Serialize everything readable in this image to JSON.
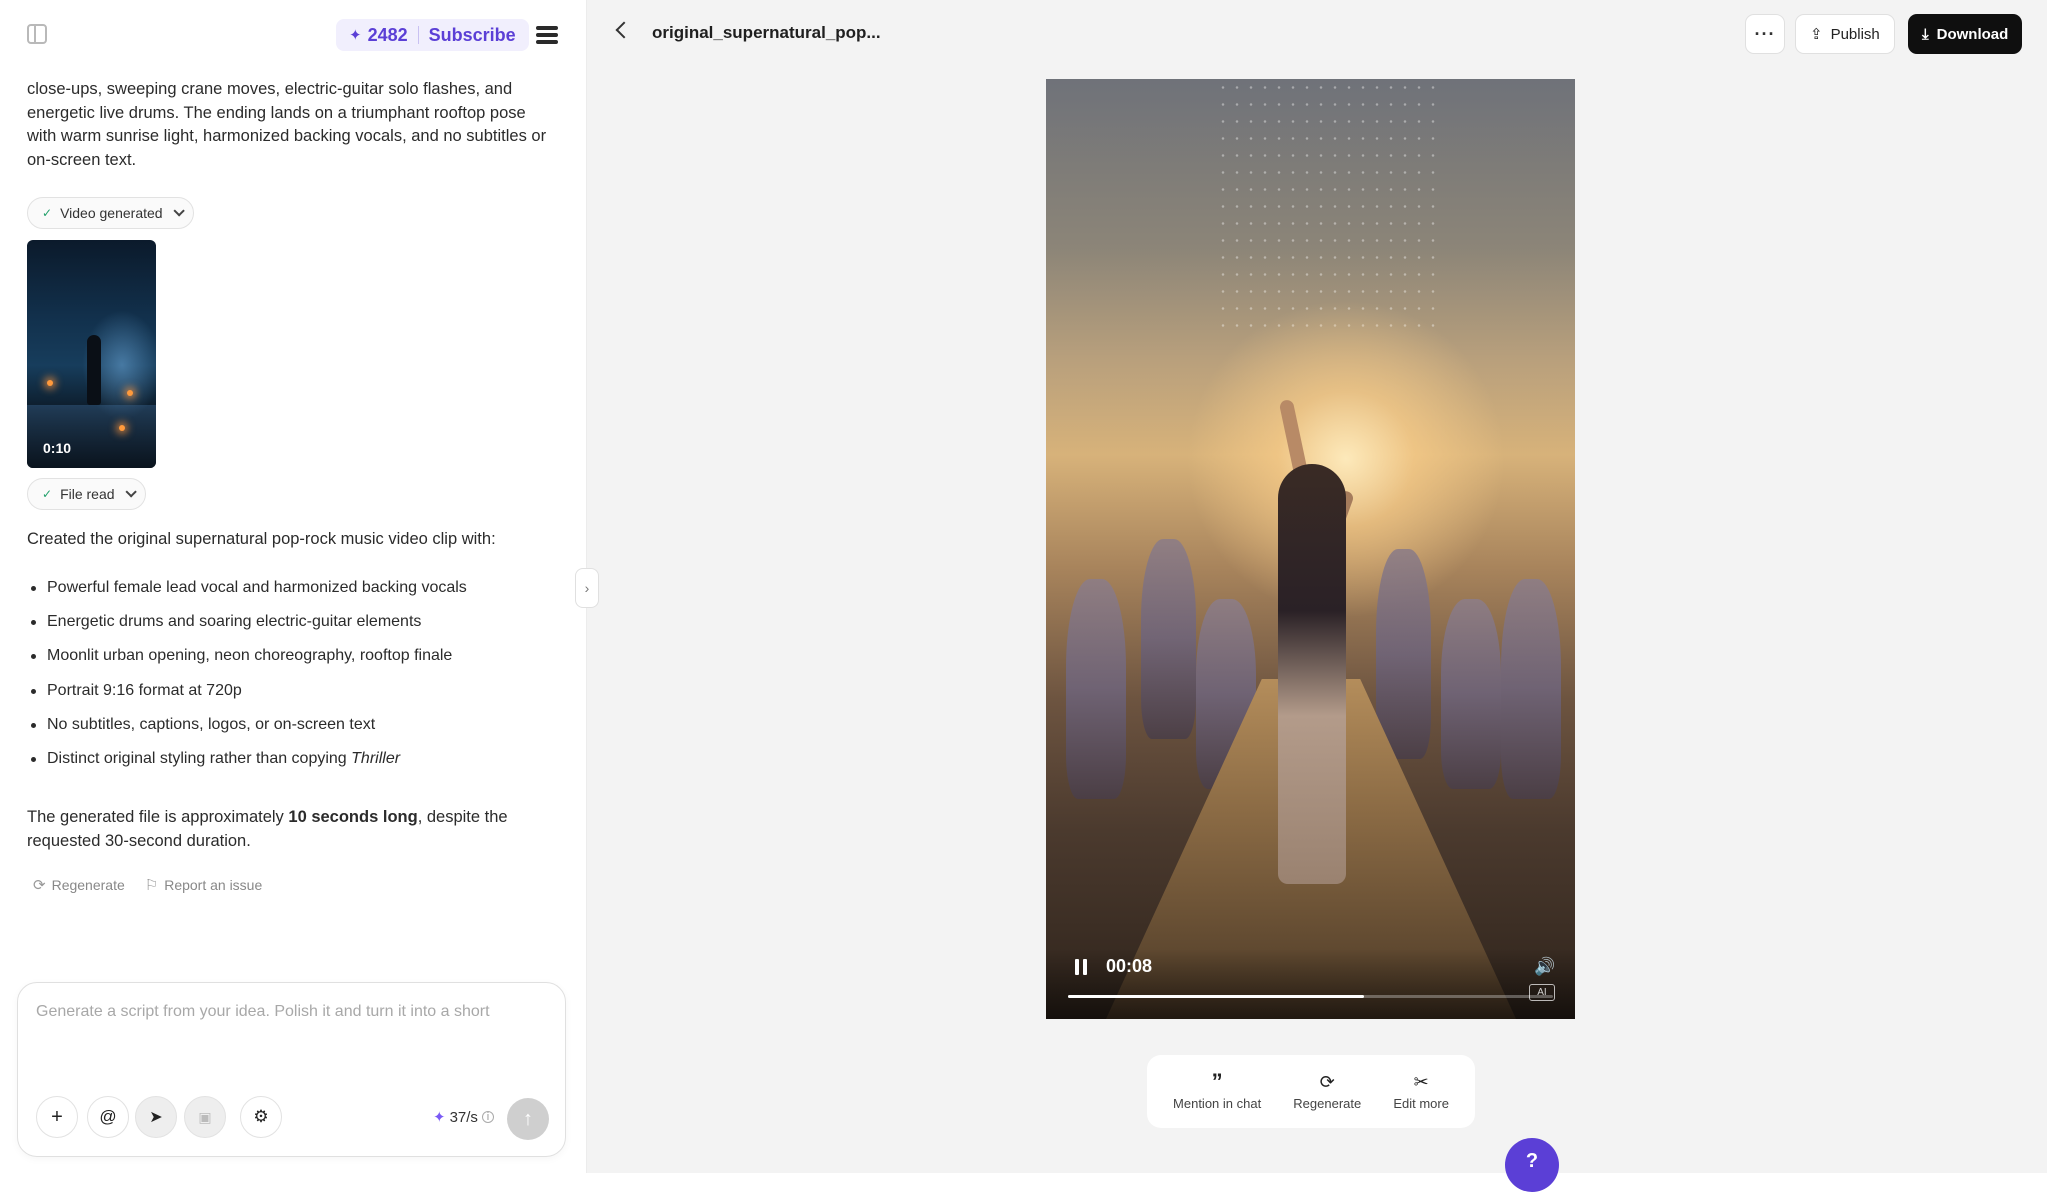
{
  "header": {
    "credits": "2482",
    "subscribe_label": "Subscribe",
    "credit_icon": "sparkle-icon"
  },
  "chat": {
    "message_text": "close-ups, sweeping crane moves, electric-guitar solo flashes, and energetic live drums. The ending lands on a triumphant rooftop pose with warm sunrise light, harmonized backing vocals, and no subtitles or on-screen text.",
    "video_status_label": "Video generated",
    "thumbnail_duration": "0:10",
    "file_status_label": "File read",
    "created_line": "Created the original supernatural pop-rock music video clip with:",
    "bullets": [
      "Powerful female lead vocal and harmonized backing vocals",
      "Energetic drums and soaring electric-guitar elements",
      "Moonlit urban opening, neon choreography, rooftop finale",
      "Portrait 9:16 format at 720p",
      "No subtitles, captions, logos, or on-screen text"
    ],
    "last_bullet_prefix": "Distinct original styling rather than copying ",
    "last_bullet_title": "Thriller",
    "summary_prefix": "The generated file is approximately ",
    "summary_bold": "10 seconds long",
    "summary_suffix": ", despite the requested 30-second duration.",
    "regenerate_label": "Regenerate",
    "report_label": "Report an issue"
  },
  "composer": {
    "placeholder": "Generate a script from your idea. Polish it and turn it into a short",
    "rate": "37/s",
    "tools": [
      "plus-icon",
      "mention-icon",
      "cursor-icon",
      "media-icon",
      "settings-sliders-icon"
    ]
  },
  "preview": {
    "file_title": "original_supernatural_pop...",
    "more_label": "···",
    "publish_label": "Publish",
    "download_label": "Download",
    "current_time": "00:08",
    "progress": 0.61,
    "ai_badge": "AI",
    "toolbar": {
      "mention_label": "Mention in chat",
      "regenerate_label": "Regenerate",
      "edit_label": "Edit more"
    }
  },
  "colors": {
    "accent": "#5b3fd6",
    "download_bg": "#0f0f0f",
    "preview_bg": "#f3f3f3"
  }
}
